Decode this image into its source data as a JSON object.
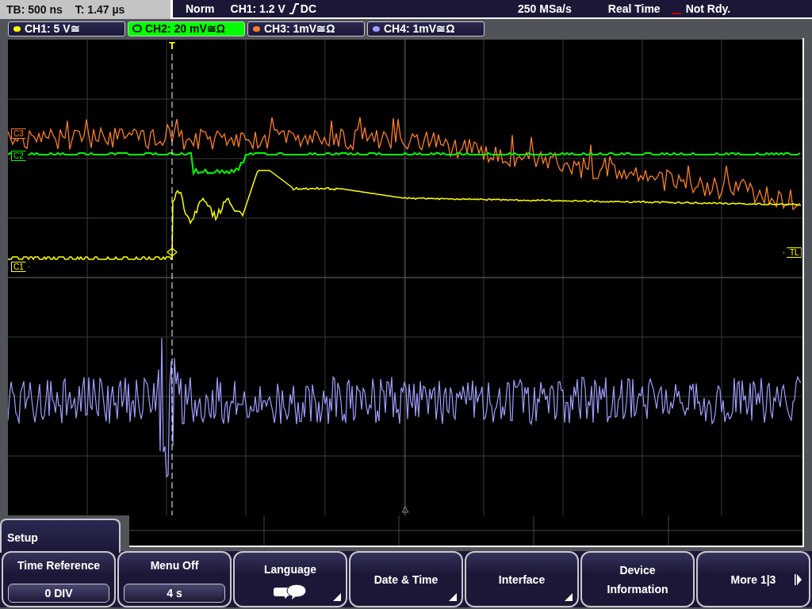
{
  "status_bar": {
    "timebase": "TB: 500 ns",
    "trigger_time": "T: 1.47 µs",
    "trigger_mode": "Norm",
    "trigger_source": "CH1: 1.2 V",
    "trigger_coupling": "DC",
    "sample_rate": "250 MSa/s",
    "acquisition_mode": "Real Time",
    "status": "Not Rdy."
  },
  "channels": [
    {
      "label": "CH1: 5 V≅",
      "color": "#ffff00",
      "selected": false
    },
    {
      "label": "CH2: 20 mV≅Ω",
      "color": "#00ff00",
      "selected": true
    },
    {
      "label": "CH3: 1mV≅Ω",
      "color": "#ff7f27",
      "selected": false
    },
    {
      "label": "CH4: 1mV≅Ω",
      "color": "#9f9fff",
      "selected": false
    }
  ],
  "screen": {
    "trigger_marker": "T",
    "trigger_level": "TL",
    "markers": [
      {
        "label": "C3",
        "color": "#ff7f27"
      },
      {
        "label": "C2",
        "color": "#00ff00"
      },
      {
        "label": "C1",
        "color": "#ffff00"
      }
    ]
  },
  "menu": {
    "title": "Setup",
    "softkeys": [
      {
        "kind": "value",
        "label": "Time Reference",
        "value": "0 DIV"
      },
      {
        "kind": "value",
        "label": "Menu Off",
        "value": "4 s"
      },
      {
        "kind": "icon",
        "label": "Language",
        "submenu": true
      },
      {
        "kind": "plain",
        "label": "Date & Time",
        "submenu": true
      },
      {
        "kind": "plain",
        "label": "Interface",
        "submenu": true
      },
      {
        "kind": "plain",
        "label": "Device Information",
        "submenu": false
      },
      {
        "kind": "next",
        "label": "More 1|3"
      }
    ]
  }
}
